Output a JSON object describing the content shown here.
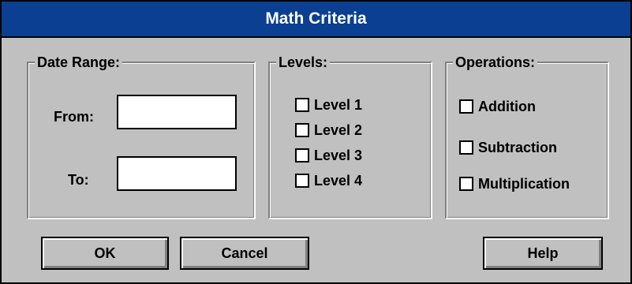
{
  "window": {
    "title": "Math Criteria",
    "title_bar_color": "#0a3f91"
  },
  "date_range": {
    "title": "Date Range:",
    "from_label": "From:",
    "from_value": "",
    "to_label": "To:",
    "to_value": ""
  },
  "levels": {
    "title": "Levels:",
    "items": [
      {
        "label": "Level 1",
        "checked": false
      },
      {
        "label": "Level 2",
        "checked": false
      },
      {
        "label": "Level 3",
        "checked": false
      },
      {
        "label": "Level 4",
        "checked": false
      }
    ]
  },
  "operations": {
    "title": "Operations:",
    "items": [
      {
        "label": "Addition",
        "checked": false
      },
      {
        "label": "Subtraction",
        "checked": false
      },
      {
        "label": "Multiplication",
        "checked": false
      }
    ]
  },
  "buttons": {
    "ok": "OK",
    "cancel": "Cancel",
    "help": "Help"
  }
}
